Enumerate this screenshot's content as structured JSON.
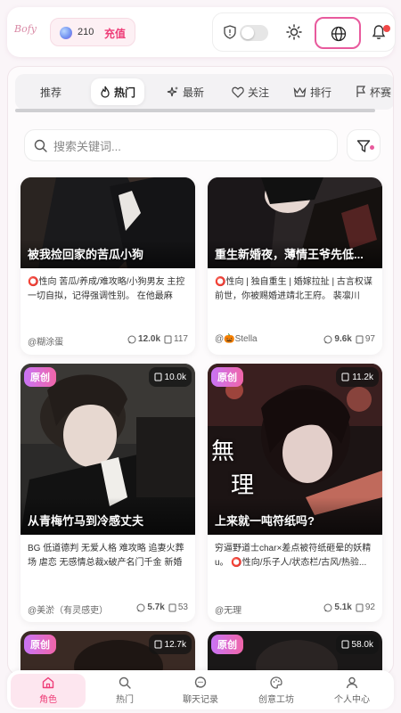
{
  "header": {
    "logo_text": "Bofy",
    "coins": "210",
    "recharge_label": "充值",
    "accent": "#ee3d78"
  },
  "tabs": [
    {
      "label": "推荐",
      "icon": ""
    },
    {
      "label": "热门",
      "icon": "flame-icon",
      "active": true
    },
    {
      "label": "最新",
      "icon": "sparkle-icon"
    },
    {
      "label": "关注",
      "icon": "heart-icon"
    },
    {
      "label": "排行",
      "icon": "crown-icon"
    },
    {
      "label": "杯赛",
      "icon": "flag-icon"
    }
  ],
  "search": {
    "placeholder": "搜索关键词..."
  },
  "cards": [
    {
      "title": "被我捡回家的苦瓜小狗",
      "desc": "⭕性向 苦瓜/养成/难攻略/小狗男友 主控一切自拟，记得强调性别。 在他最麻木...",
      "author": "@糊涂蛋",
      "chats": "12.0k",
      "count": "117"
    },
    {
      "title": "重生新婚夜，薄情王爷先低...",
      "desc": "⭕性向 | 独自重生 | 婚嫁拉扯 | 古言权谋 前世，你被赐婚进靖北王府。 裴凛川给...",
      "author": "@🎃Stella",
      "chats": "9.6k",
      "count": "97"
    },
    {
      "badge": "原创",
      "top_count": "10.0k",
      "title": "从青梅竹马到冷感丈夫",
      "desc": "BG 低道德判 无爱人格 难攻略 追妻火葬场 虐恋 无感情总裁x破产名门千金 新婚夜...",
      "author": "@美淤（有灵感吏）",
      "chats": "5.7k",
      "count": "53"
    },
    {
      "badge": "原创",
      "top_count": "11.2k",
      "title": "上来就一吨符纸吗?",
      "desc": "穷逼野道士char×差点被符纸砸晕的妖精u。 ⭕性向/乐子人/状态栏/古风/热验...",
      "author": "@无理",
      "chats": "5.1k",
      "count": "92",
      "art_text": [
        "無",
        "理"
      ]
    },
    {
      "badge": "原创",
      "top_count": "12.7k"
    },
    {
      "badge": "原创",
      "top_count": "58.0k"
    }
  ],
  "nav": [
    {
      "label": "角色",
      "icon": "home-icon",
      "active": true
    },
    {
      "label": "热门",
      "icon": "search-icon"
    },
    {
      "label": "聊天记录",
      "icon": "chat-icon"
    },
    {
      "label": "创意工坊",
      "icon": "palette-icon"
    },
    {
      "label": "个人中心",
      "icon": "user-icon"
    }
  ]
}
